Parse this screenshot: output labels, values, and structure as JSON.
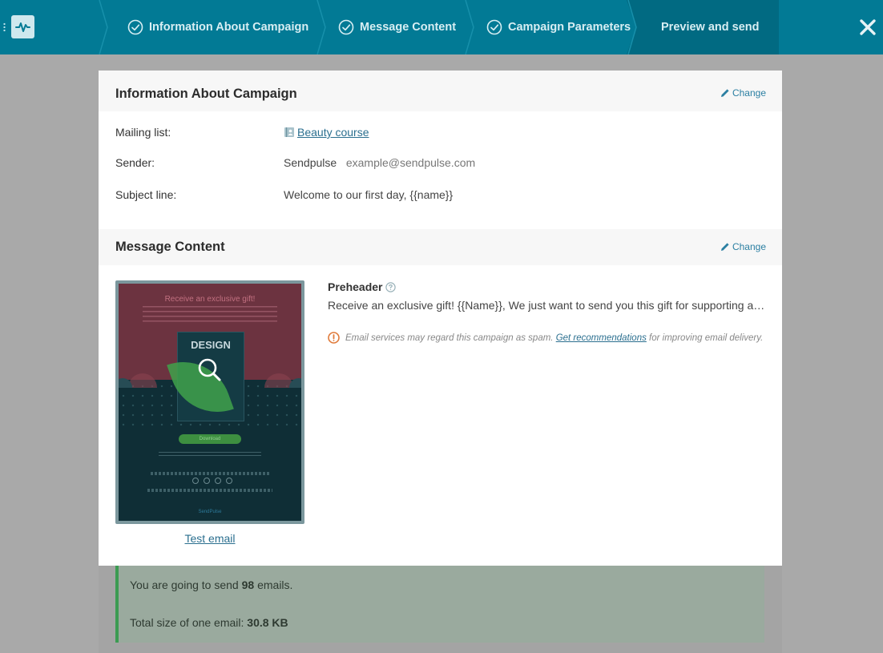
{
  "wizard": {
    "steps": [
      {
        "label": "Information About Campaign",
        "done": true
      },
      {
        "label": "Message Content",
        "done": true
      },
      {
        "label": "Campaign Parameters",
        "done": true
      },
      {
        "label": "Preview and send",
        "done": false,
        "active": true
      }
    ]
  },
  "info_section": {
    "title": "Information About Campaign",
    "change_label": "Change",
    "mailing_list_label": "Mailing list:",
    "mailing_list_value": "Beauty course",
    "sender_label": "Sender:",
    "sender_name": "Sendpulse",
    "sender_email": "example@sendpulse.com",
    "subject_label": "Subject line:",
    "subject_value": "Welcome to our first day, {{name}}"
  },
  "content_section": {
    "title": "Message Content",
    "change_label": "Change",
    "thumbnail": {
      "headline": "Receive an exclusive gift!",
      "book_title": "DESIGN",
      "button": "Download",
      "brand": "SendPulse"
    },
    "test_email_label": "Test email",
    "preheader_label": "Preheader",
    "preheader_text": "Receive an exclusive gift! {{Name}}, We just want to send you this gift for supporting and …",
    "warning_prefix": "Email services may regard this campaign as spam.",
    "warning_link": "Get recommendations",
    "warning_suffix": "for improving email delivery."
  },
  "summary": {
    "send_prefix": "You are going to send",
    "send_count": "98",
    "send_suffix": "emails.",
    "size_label": "Total size of one email:",
    "size_value": "30.8 KB"
  },
  "colors": {
    "topbar": "#027a95",
    "active_step": "#016a82",
    "link": "#2b6f8f",
    "summary_accent": "#3c9b52",
    "warning": "#e07a3a"
  }
}
